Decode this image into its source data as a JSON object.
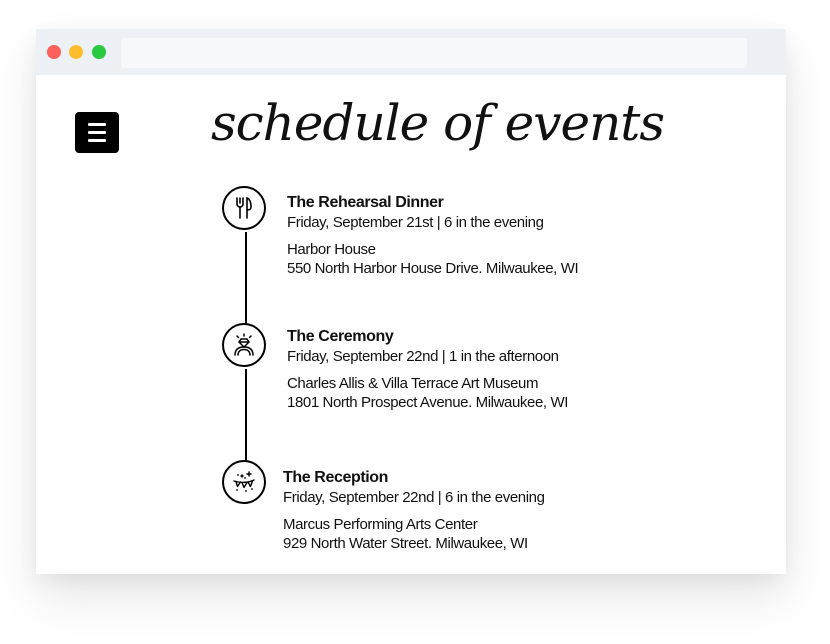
{
  "browser": {
    "traffic_lights": [
      {
        "name": "close",
        "color": "#ff605c"
      },
      {
        "name": "minimize",
        "color": "#ffbd2e"
      },
      {
        "name": "maximize",
        "color": "#28c840"
      }
    ],
    "address_bar": {
      "value": ""
    }
  },
  "header": {
    "menu_icon": "hamburger-menu-icon",
    "title": "schedule of events"
  },
  "events": [
    {
      "icon": "fork-knife-icon",
      "title": "The Rehearsal Dinner",
      "when": "Friday, September 21st | 6 in the evening",
      "venue": "Harbor House",
      "address": "550 North Harbor House Drive. Milwaukee, WI"
    },
    {
      "icon": "diamond-ring-icon",
      "title": "The Ceremony",
      "when": "Friday, September 22nd | 1 in the afternoon",
      "venue": "Charles Allis & Villa Terrace Art Museum",
      "address": "1801 North Prospect Avenue. Milwaukee, WI"
    },
    {
      "icon": "party-bunting-icon",
      "title": "The Reception",
      "when": "Friday, September 22nd | 6 in the evening",
      "venue": "Marcus Performing Arts Center",
      "address": "929 North Water Street. Milwaukee, WI"
    }
  ]
}
